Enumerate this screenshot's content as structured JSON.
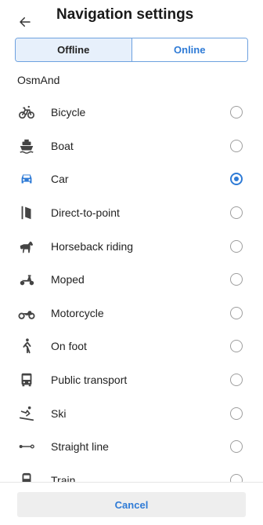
{
  "header": {
    "title": "Navigation settings",
    "back_icon": "arrow-back-icon"
  },
  "tabs": [
    {
      "label": "Offline",
      "active": true
    },
    {
      "label": "Online",
      "active": false
    }
  ],
  "section": {
    "title": "OsmAnd"
  },
  "profiles": [
    {
      "label": "Bicycle",
      "icon": "bicycle-icon",
      "selected": false
    },
    {
      "label": "Boat",
      "icon": "boat-icon",
      "selected": false
    },
    {
      "label": "Car",
      "icon": "car-icon",
      "selected": true
    },
    {
      "label": "Direct-to-point",
      "icon": "direct-to-point-icon",
      "selected": false
    },
    {
      "label": "Horseback riding",
      "icon": "horse-icon",
      "selected": false
    },
    {
      "label": "Moped",
      "icon": "moped-icon",
      "selected": false
    },
    {
      "label": "Motorcycle",
      "icon": "motorcycle-icon",
      "selected": false
    },
    {
      "label": "On foot",
      "icon": "pedestrian-icon",
      "selected": false
    },
    {
      "label": "Public transport",
      "icon": "bus-icon",
      "selected": false
    },
    {
      "label": "Ski",
      "icon": "ski-icon",
      "selected": false
    },
    {
      "label": "Straight line",
      "icon": "straight-line-icon",
      "selected": false
    },
    {
      "label": "Train",
      "icon": "train-icon",
      "selected": false
    }
  ],
  "footer": {
    "cancel_label": "Cancel"
  },
  "colors": {
    "accent": "#2f7bd6",
    "icon": "#444444",
    "selected_tab_bg": "#e7f0fb"
  }
}
